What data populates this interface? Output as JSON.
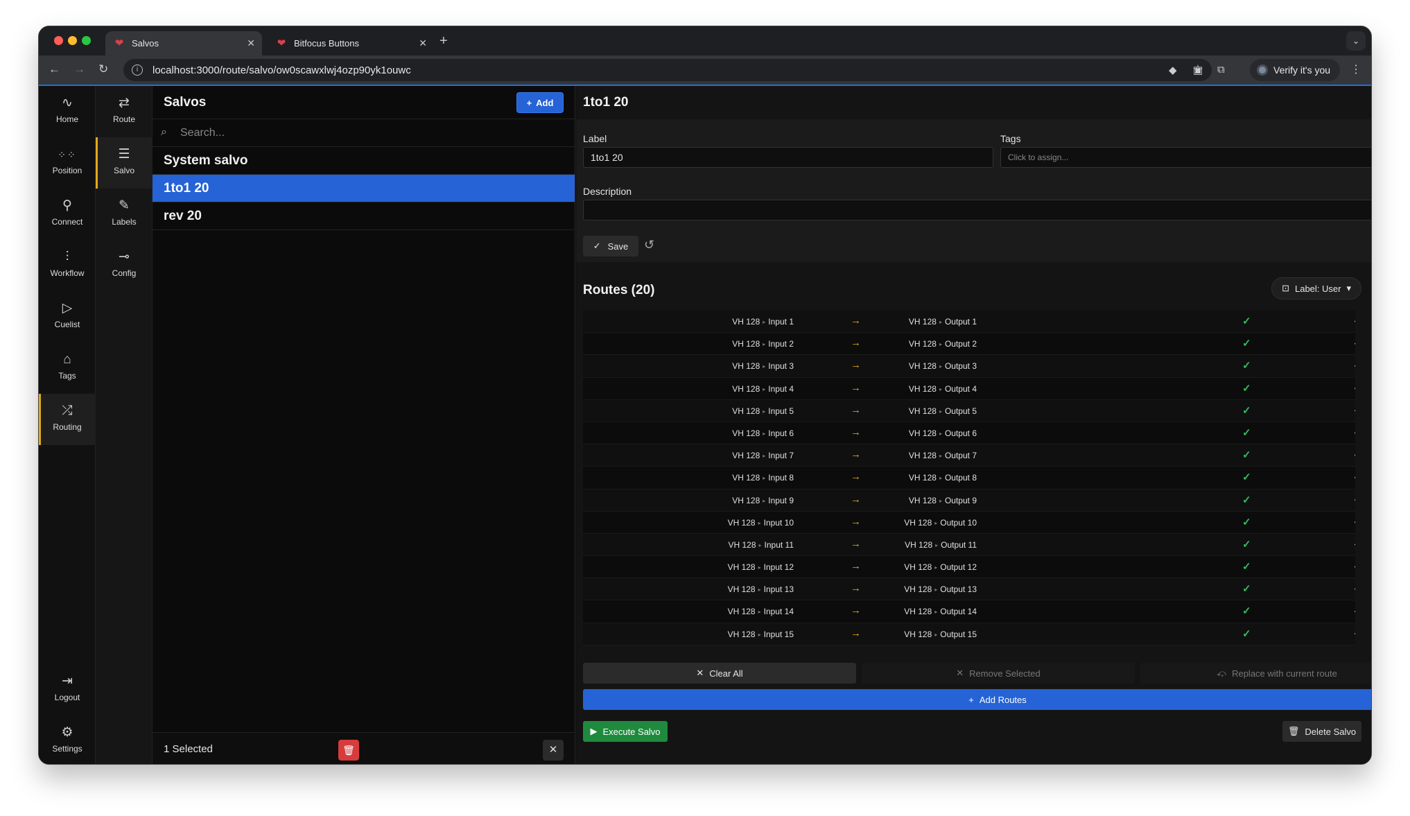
{
  "browser": {
    "tabs": [
      {
        "title": "Salvos",
        "active": true
      },
      {
        "title": "Bitfocus Buttons",
        "active": false
      }
    ],
    "url": "localhost:3000/route/salvo/ow0scawxlwj4ozp90yk1ouwc",
    "verify_label": "Verify it's you"
  },
  "rail_primary": [
    {
      "label": "Home",
      "icon": "activity-icon"
    },
    {
      "label": "Position",
      "icon": "grid-icon"
    },
    {
      "label": "Connect",
      "icon": "plug-icon"
    },
    {
      "label": "Workflow",
      "icon": "workflow-icon"
    },
    {
      "label": "Cuelist",
      "icon": "play-icon"
    },
    {
      "label": "Tags",
      "icon": "tag-icon"
    },
    {
      "label": "Routing",
      "icon": "shuffle-icon",
      "selected": true
    }
  ],
  "rail_bottom": [
    {
      "label": "Logout",
      "icon": "logout-icon"
    },
    {
      "label": "Settings",
      "icon": "gear-icon"
    }
  ],
  "rail_secondary": [
    {
      "label": "Route",
      "icon": "route-icon"
    },
    {
      "label": "Salvo",
      "icon": "list-icon",
      "selected": true
    },
    {
      "label": "Labels",
      "icon": "edit-icon"
    },
    {
      "label": "Config",
      "icon": "config-icon"
    }
  ],
  "salvo_list": {
    "title": "Salvos",
    "add_label": "Add",
    "search_placeholder": "Search...",
    "items": [
      {
        "label": "System salvo",
        "selected": false
      },
      {
        "label": "1to1 20",
        "selected": true
      },
      {
        "label": "rev 20",
        "selected": false
      }
    ],
    "footer_selected": "1 Selected"
  },
  "detail": {
    "title": "1to1 20",
    "label_field_label": "Label",
    "label_value": "1to1  20",
    "tags_field_label": "Tags",
    "tags_placeholder": "Click to assign...",
    "description_label": "Description",
    "description_value": "",
    "save_label": "Save",
    "routes_title": "Routes (20)",
    "label_mode": "Label: User",
    "routes": [
      {
        "src_device": "VH 128",
        "src_port": "Input 1",
        "dst_device": "VH 128",
        "dst_port": "Output 1"
      },
      {
        "src_device": "VH 128",
        "src_port": "Input 2",
        "dst_device": "VH 128",
        "dst_port": "Output 2"
      },
      {
        "src_device": "VH 128",
        "src_port": "Input 3",
        "dst_device": "VH 128",
        "dst_port": "Output 3"
      },
      {
        "src_device": "VH 128",
        "src_port": "Input 4",
        "dst_device": "VH 128",
        "dst_port": "Output 4"
      },
      {
        "src_device": "VH 128",
        "src_port": "Input 5",
        "dst_device": "VH 128",
        "dst_port": "Output 5"
      },
      {
        "src_device": "VH 128",
        "src_port": "Input 6",
        "dst_device": "VH 128",
        "dst_port": "Output 6"
      },
      {
        "src_device": "VH 128",
        "src_port": "Input 7",
        "dst_device": "VH 128",
        "dst_port": "Output 7"
      },
      {
        "src_device": "VH 128",
        "src_port": "Input 8",
        "dst_device": "VH 128",
        "dst_port": "Output 8"
      },
      {
        "src_device": "VH 128",
        "src_port": "Input 9",
        "dst_device": "VH 128",
        "dst_port": "Output 9"
      },
      {
        "src_device": "VH 128",
        "src_port": "Input 10",
        "dst_device": "VH 128",
        "dst_port": "Output 10"
      },
      {
        "src_device": "VH 128",
        "src_port": "Input 11",
        "dst_device": "VH 128",
        "dst_port": "Output 11"
      },
      {
        "src_device": "VH 128",
        "src_port": "Input 12",
        "dst_device": "VH 128",
        "dst_port": "Output 12"
      },
      {
        "src_device": "VH 128",
        "src_port": "Input 13",
        "dst_device": "VH 128",
        "dst_port": "Output 13"
      },
      {
        "src_device": "VH 128",
        "src_port": "Input 14",
        "dst_device": "VH 128",
        "dst_port": "Output 14"
      },
      {
        "src_device": "VH 128",
        "src_port": "Input 15",
        "dst_device": "VH 128",
        "dst_port": "Output 15"
      }
    ],
    "clear_all_label": "Clear All",
    "remove_selected_label": "Remove Selected",
    "replace_label": "Replace with current route",
    "add_routes_label": "Add Routes",
    "execute_label": "Execute Salvo",
    "delete_label": "Delete Salvo"
  },
  "colors": {
    "accent_blue": "#2563d6",
    "rail_highlight": "#e4a91b",
    "route_arrow": "#e4a91b",
    "route_check": "#2fbf5a",
    "execute_green": "#1f8a3d",
    "danger_red": "#d63c3c"
  }
}
